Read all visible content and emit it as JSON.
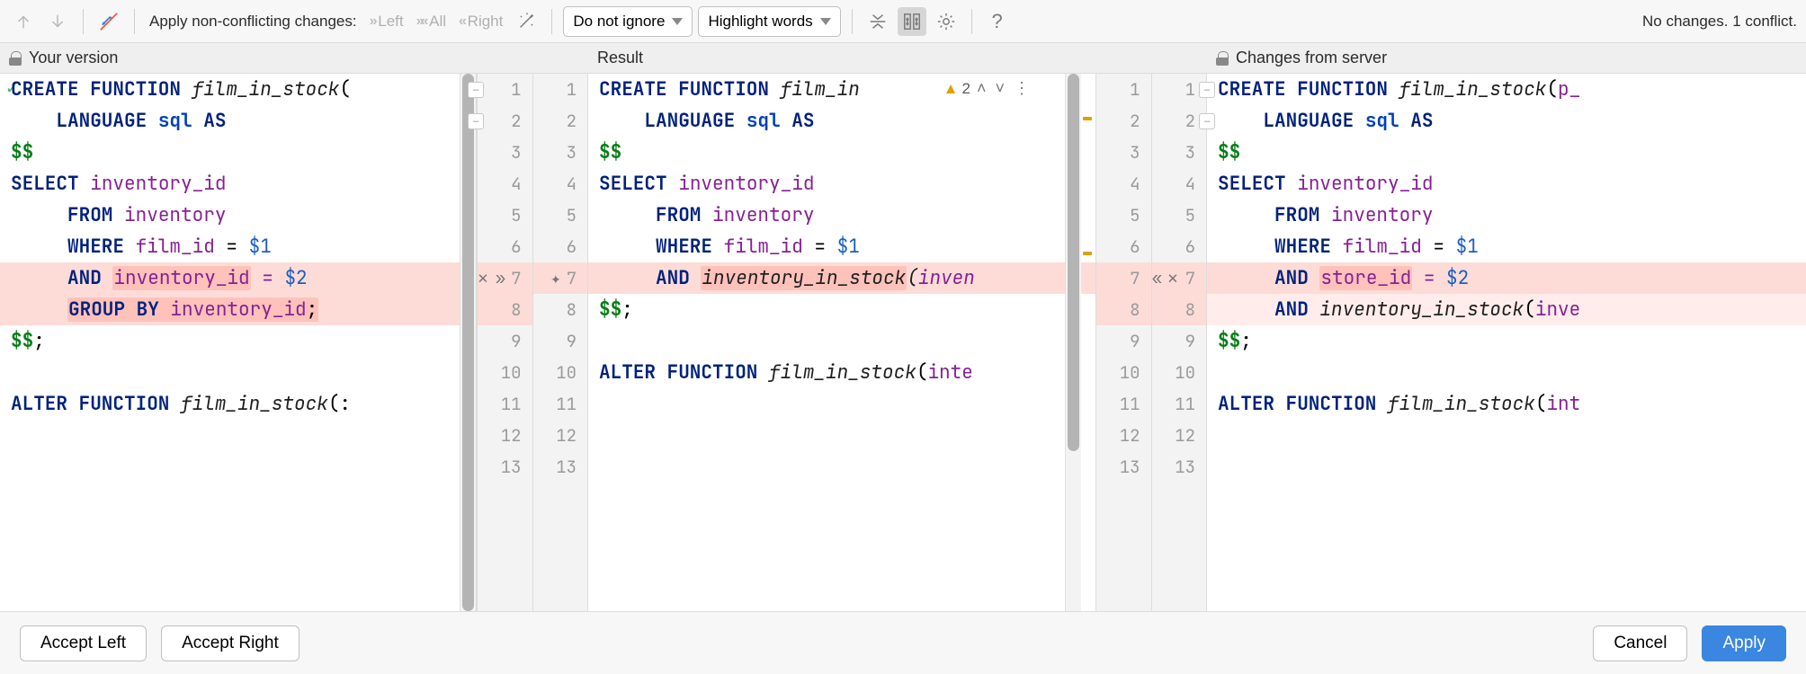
{
  "toolbar": {
    "apply_label": "Apply non-conflicting changes:",
    "left_label": "Left",
    "all_label": "All",
    "right_label": "Right",
    "ignore_select": "Do not ignore",
    "highlight_select": "Highlight words",
    "status_text": "No changes. 1 conflict."
  },
  "headers": {
    "left": "Your version",
    "center": "Result",
    "right": "Changes from server"
  },
  "code": {
    "left": [
      {
        "t": "CREATE FUNCTION film_in_stock("
      },
      {
        "t": "    LANGUAGE sql AS"
      },
      {
        "t": "$$"
      },
      {
        "t": "SELECT inventory_id"
      },
      {
        "t": "     FROM inventory"
      },
      {
        "t": "     WHERE film_id = $1"
      },
      {
        "t": "     AND inventory_id = $2",
        "conf": true
      },
      {
        "t": "     GROUP BY inventory_id;",
        "conf": true
      },
      {
        "t": "$$;"
      },
      {
        "t": ""
      },
      {
        "t": "ALTER FUNCTION film_in_stock(:"
      }
    ],
    "center": [
      {
        "t": "CREATE FUNCTION film_in"
      },
      {
        "t": "    LANGUAGE sql AS"
      },
      {
        "t": "$$"
      },
      {
        "t": "SELECT inventory_id"
      },
      {
        "t": "     FROM inventory"
      },
      {
        "t": "     WHERE film_id = $1"
      },
      {
        "t": "     AND inventory_in_stock(inven",
        "conf": true
      },
      {
        "t": "$$;"
      },
      {
        "t": ""
      },
      {
        "t": "ALTER FUNCTION film_in_stock(inte"
      }
    ],
    "right": [
      {
        "t": "CREATE FUNCTION film_in_stock(p_"
      },
      {
        "t": "    LANGUAGE sql AS"
      },
      {
        "t": "$$"
      },
      {
        "t": "SELECT inventory_id"
      },
      {
        "t": "     FROM inventory"
      },
      {
        "t": "     WHERE film_id = $1"
      },
      {
        "t": "     AND store_id = $2",
        "conf": true
      },
      {
        "t": "     AND inventory_in_stock(inve",
        "conflite": true
      },
      {
        "t": "$$;"
      },
      {
        "t": ""
      },
      {
        "t": "ALTER FUNCTION film_in_stock(int"
      }
    ]
  },
  "gutters": {
    "left_numbers": [
      "1",
      "2",
      "3",
      "4",
      "5",
      "6",
      "7",
      "8",
      "9",
      "10",
      "11",
      "12",
      "13"
    ],
    "center_numbers": [
      "1",
      "2",
      "3",
      "4",
      "5",
      "6",
      "7",
      "8",
      "9",
      "10",
      "11",
      "12",
      "13"
    ],
    "right_numbers": [
      "1",
      "2",
      "3",
      "4",
      "5",
      "6",
      "7",
      "8",
      "9",
      "10",
      "11",
      "12",
      "13"
    ]
  },
  "center_badge": {
    "count": "2"
  },
  "bottom": {
    "accept_left": "Accept Left",
    "accept_right": "Accept Right",
    "cancel": "Cancel",
    "apply": "Apply"
  }
}
